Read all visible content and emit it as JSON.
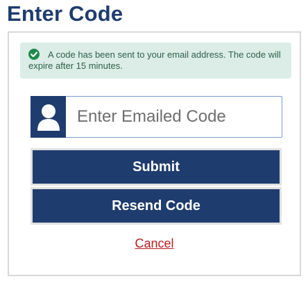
{
  "page": {
    "title": "Enter Code"
  },
  "alert": {
    "icon": "check-circle-icon",
    "message": "A code has been sent to your email address. The code will expire after 15 minutes.",
    "colors": {
      "background": "#dbede6",
      "icon": "#1f8a4c",
      "text": "#2f5f4c"
    }
  },
  "code_field": {
    "icon": "user-icon",
    "placeholder": "Enter Emailed Code",
    "value": ""
  },
  "buttons": {
    "submit_label": "Submit",
    "resend_label": "Resend Code"
  },
  "cancel": {
    "label": "Cancel"
  },
  "colors": {
    "primary": "#1f3c6e",
    "cancel_link": "#b91c1c"
  }
}
